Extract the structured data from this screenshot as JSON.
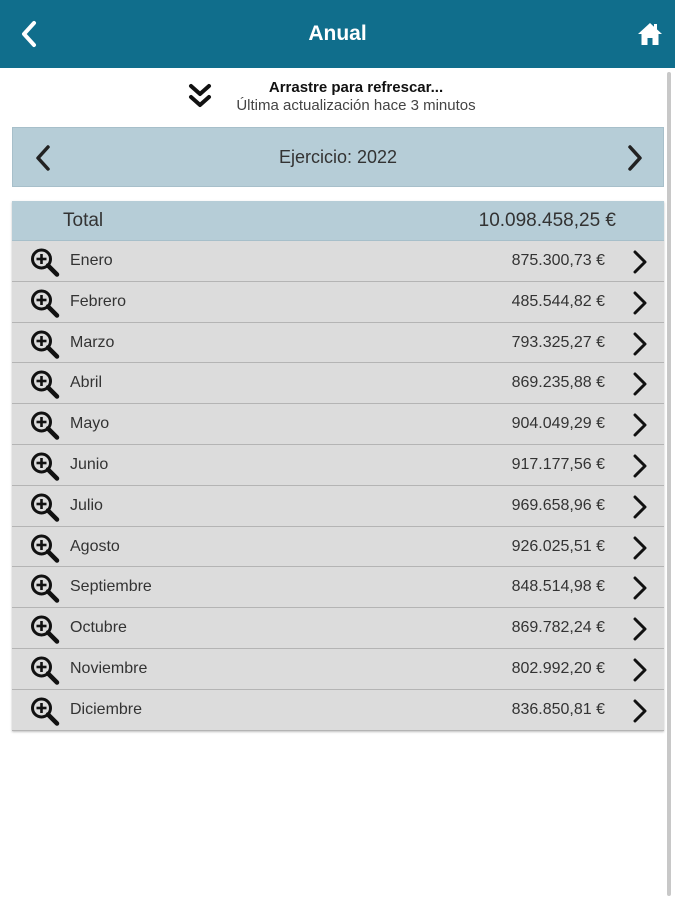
{
  "header": {
    "title": "Anual",
    "back_icon": "chevron-left-icon",
    "home_icon": "home-icon",
    "bg_color": "#106e8c"
  },
  "refresh": {
    "title": "Arrastre para refrescar...",
    "subtitle": "Última actualización hace 3 minutos",
    "icon": "double-chevron-down-icon"
  },
  "year_selector": {
    "label": "Ejercicio: 2022",
    "prev_icon": "chevron-left-icon",
    "next_icon": "chevron-right-icon"
  },
  "summary": {
    "total_label": "Total",
    "total_value": "10.098.458,25 €"
  },
  "months": [
    {
      "name": "Enero",
      "amount": "875.300,73 €"
    },
    {
      "name": "Febrero",
      "amount": "485.544,82 €"
    },
    {
      "name": "Marzo",
      "amount": "793.325,27 €"
    },
    {
      "name": "Abril",
      "amount": "869.235,88 €"
    },
    {
      "name": "Mayo",
      "amount": "904.049,29 €"
    },
    {
      "name": "Junio",
      "amount": "917.177,56 €"
    },
    {
      "name": "Julio",
      "amount": "969.658,96 €"
    },
    {
      "name": "Agosto",
      "amount": "926.025,51 €"
    },
    {
      "name": "Septiembre",
      "amount": "848.514,98 €"
    },
    {
      "name": "Octubre",
      "amount": "869.782,24 €"
    },
    {
      "name": "Noviembre",
      "amount": "802.992,20 €"
    },
    {
      "name": "Diciembre",
      "amount": "836.850,81 €"
    }
  ],
  "row_icons": {
    "zoom": "zoom-in-icon",
    "detail": "chevron-right-icon"
  },
  "colors": {
    "accent": "#106e8c",
    "band": "#b6cdd7",
    "row": "#dcdcdc"
  }
}
